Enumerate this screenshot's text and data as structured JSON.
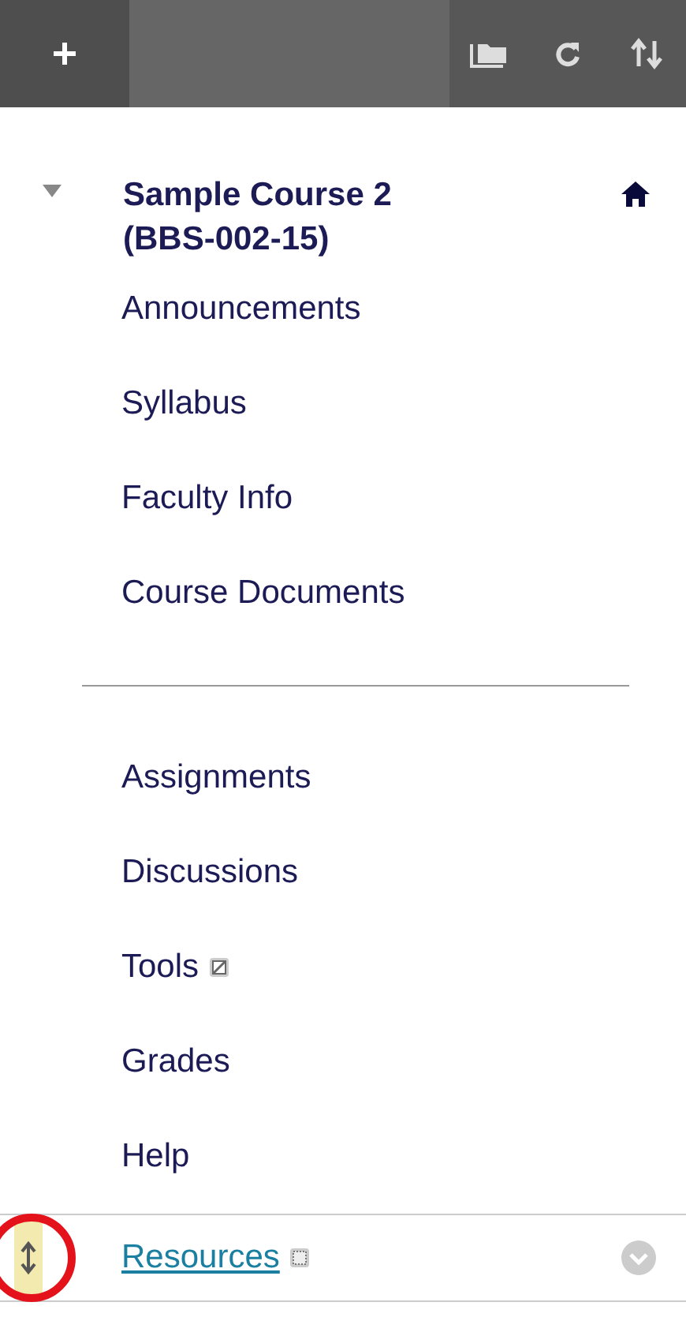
{
  "toolbar": {
    "buttons": [
      {
        "kind": "add"
      },
      {
        "kind": "folder"
      },
      {
        "kind": "refresh"
      },
      {
        "kind": "reorder"
      }
    ]
  },
  "course": {
    "title": "Sample Course 2 (BBS-002-15)",
    "expanded": true
  },
  "groups": [
    {
      "items": [
        {
          "label": "Announcements",
          "selected": false
        },
        {
          "label": "Syllabus",
          "selected": false
        },
        {
          "label": "Faculty Info",
          "selected": false
        },
        {
          "label": "Course Documents",
          "selected": false
        }
      ]
    },
    {
      "items": [
        {
          "label": "Assignments",
          "selected": false
        },
        {
          "label": "Discussions",
          "selected": false
        },
        {
          "label": "Tools",
          "selected": false,
          "kind": "hidden"
        },
        {
          "label": "Grades",
          "selected": false
        },
        {
          "label": "Help",
          "selected": false
        },
        {
          "label": "Resources",
          "selected": true,
          "kind": "empty"
        }
      ]
    }
  ]
}
